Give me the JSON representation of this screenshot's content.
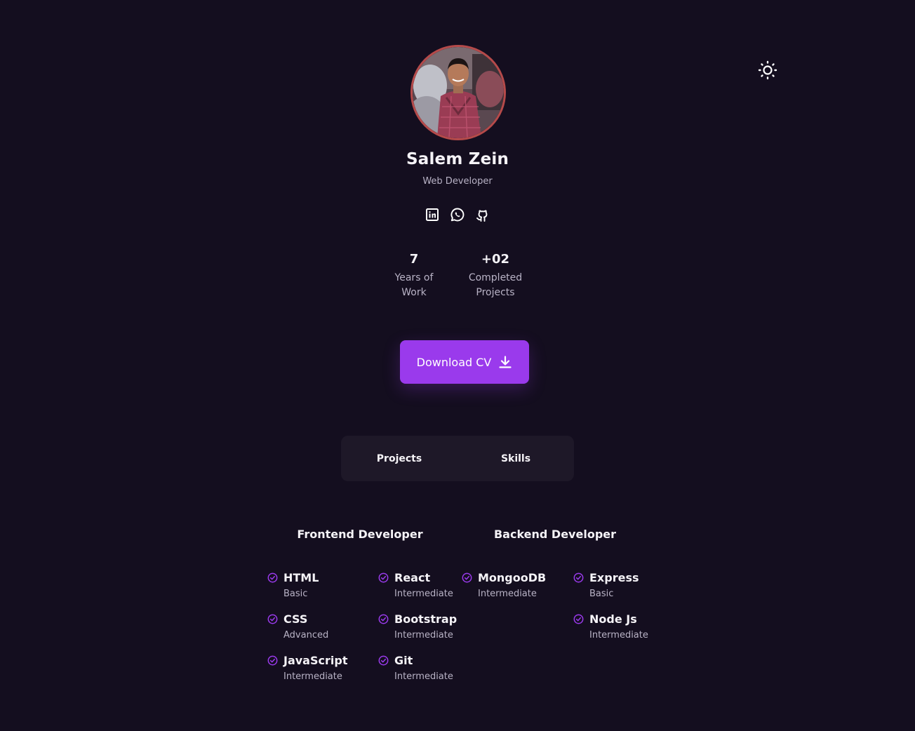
{
  "profile": {
    "name": "Salem Zein",
    "role": "Web Developer"
  },
  "socials": [
    {
      "icon": "linkedin-icon"
    },
    {
      "icon": "whatsapp-icon"
    },
    {
      "icon": "github-icon"
    }
  ],
  "stats": {
    "years": {
      "value": "7",
      "label_line1": "Years of",
      "label_line2": "Work"
    },
    "projects": {
      "value": "+02",
      "label_line1": "Completed",
      "label_line2": "Projects"
    }
  },
  "download": {
    "label": "Download CV",
    "icon": "download-icon"
  },
  "tabs": [
    {
      "label": "Projects"
    },
    {
      "label": "Skills"
    }
  ],
  "skills": {
    "frontend": {
      "title": "Frontend Developer",
      "items": [
        {
          "name": "HTML",
          "level": "Basic"
        },
        {
          "name": "CSS",
          "level": "Advanced"
        },
        {
          "name": "JavaScript",
          "level": "Intermediate"
        },
        {
          "name": "React",
          "level": "Intermediate"
        },
        {
          "name": "Bootstrap",
          "level": "Intermediate"
        },
        {
          "name": "Git",
          "level": "Intermediate"
        }
      ]
    },
    "backend": {
      "title": "Backend Developer",
      "items": [
        {
          "name": "MongooDB",
          "level": "Intermediate"
        },
        {
          "name": "Express",
          "level": "Basic"
        },
        {
          "name": "Node Js",
          "level": "Intermediate"
        }
      ]
    }
  },
  "colors": {
    "background": "#140e1f",
    "accent": "#9a3aec",
    "avatar_ring": "#b54a4a",
    "tab_bg": "#1e1828",
    "check": "#9a3aec"
  },
  "theme_toggle": {
    "icon": "sun-icon"
  }
}
